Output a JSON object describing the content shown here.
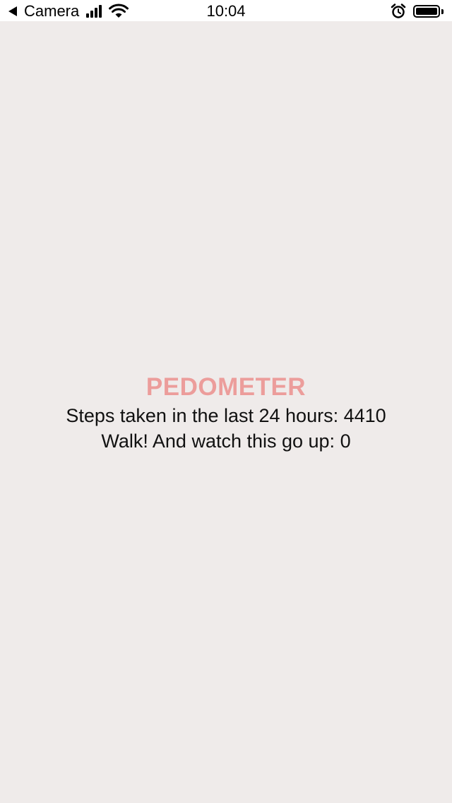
{
  "status_bar": {
    "back_label": "Camera",
    "time": "10:04",
    "signal_bars": 4,
    "battery_level": 1.0
  },
  "pedometer": {
    "title": "PEDOMETER",
    "past_steps_label": "Steps taken in the last 24 hours: 4410",
    "live_steps_label": "Walk! And watch this go up: 0"
  },
  "colors": {
    "background": "#efebea",
    "title": "#ec9d9b",
    "text": "#111111"
  }
}
